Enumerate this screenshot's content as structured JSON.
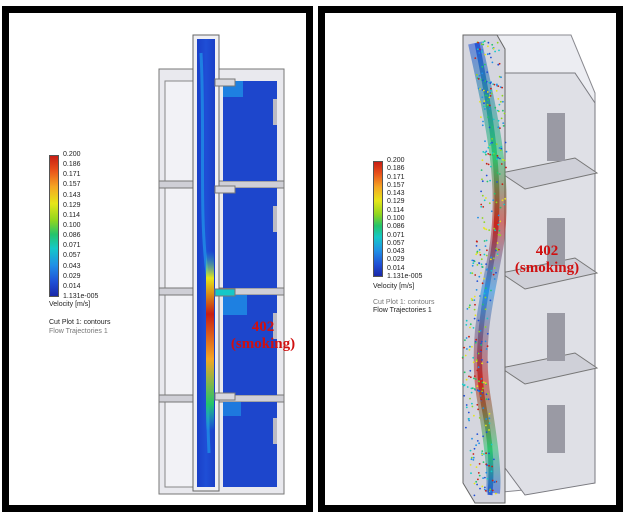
{
  "legend": {
    "ticks": [
      "0.200",
      "0.186",
      "0.171",
      "0.157",
      "0.143",
      "0.129",
      "0.114",
      "0.100",
      "0.086",
      "0.071",
      "0.057",
      "0.043",
      "0.029",
      "0.014",
      "1.131e-005"
    ],
    "unit": "Velocity [m/s]",
    "caption_cut": "Cut Plot 1: contours",
    "caption_flow": "Flow Trajectories 1"
  },
  "annotation": {
    "room": "402",
    "state": "(smoking)"
  },
  "colors": {
    "annotation": "#d01010",
    "low_velocity": "#1a3fc8",
    "high_velocity": "#c81e14"
  }
}
